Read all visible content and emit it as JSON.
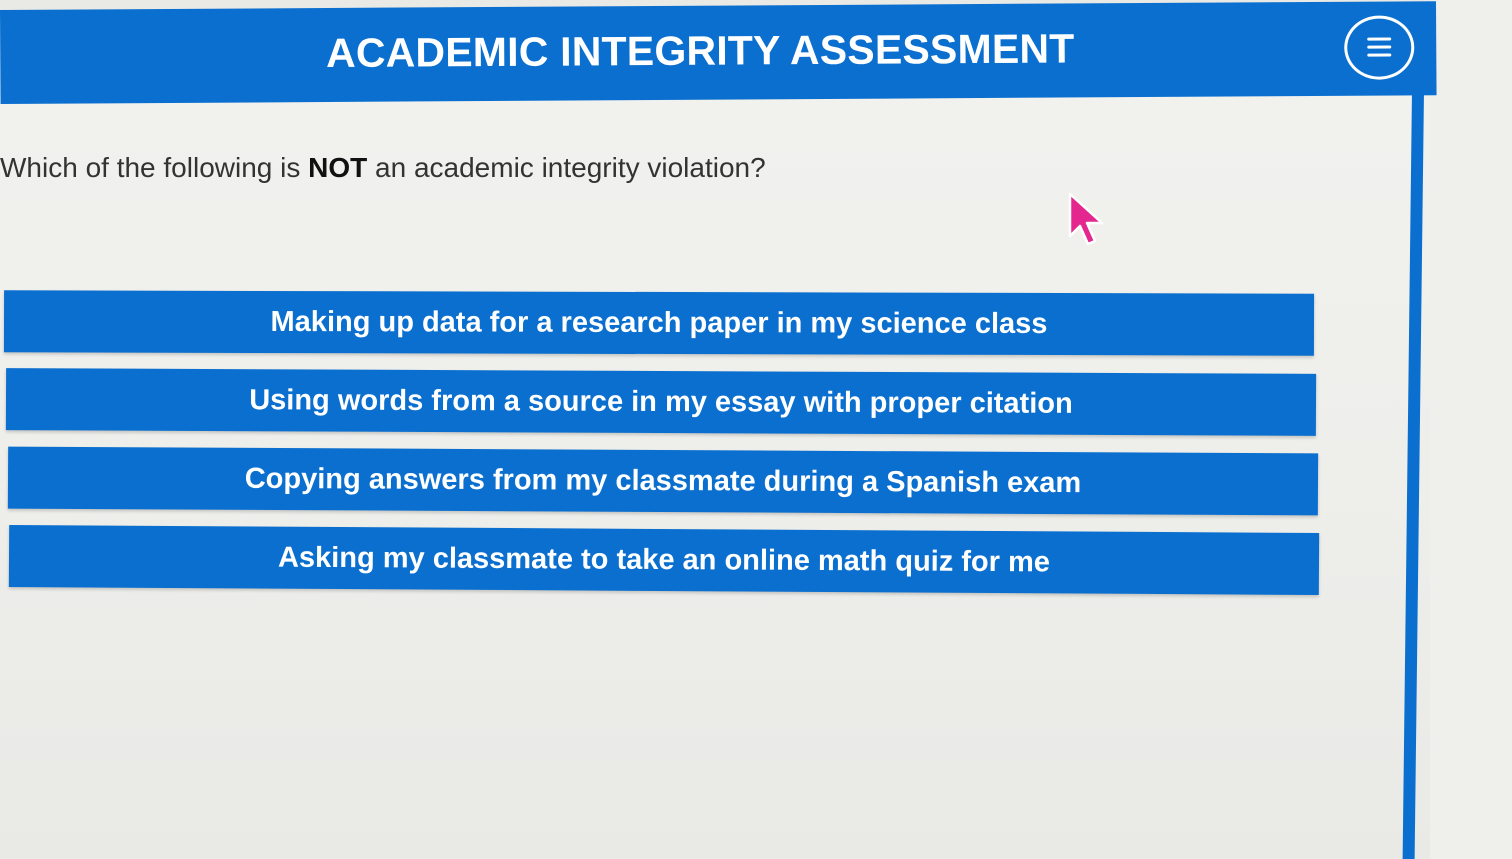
{
  "header": {
    "title": "ACADEMIC INTEGRITY ASSESSMENT",
    "menu_icon": "hamburger-menu-icon",
    "color": "#0a6fcf"
  },
  "question": {
    "prefix": "Which of the following is ",
    "emphasis": "NOT",
    "suffix": " an academic integrity violation?"
  },
  "answers": [
    {
      "label": "Making up data for a research paper in my science class"
    },
    {
      "label": "Using words from a source in my essay with proper citation"
    },
    {
      "label": "Copying answers from my classmate during a Spanish exam"
    },
    {
      "label": "Asking my classmate to take an online math quiz for me"
    }
  ],
  "cursor": {
    "icon": "mouse-pointer-icon",
    "color": "#e4268f"
  }
}
